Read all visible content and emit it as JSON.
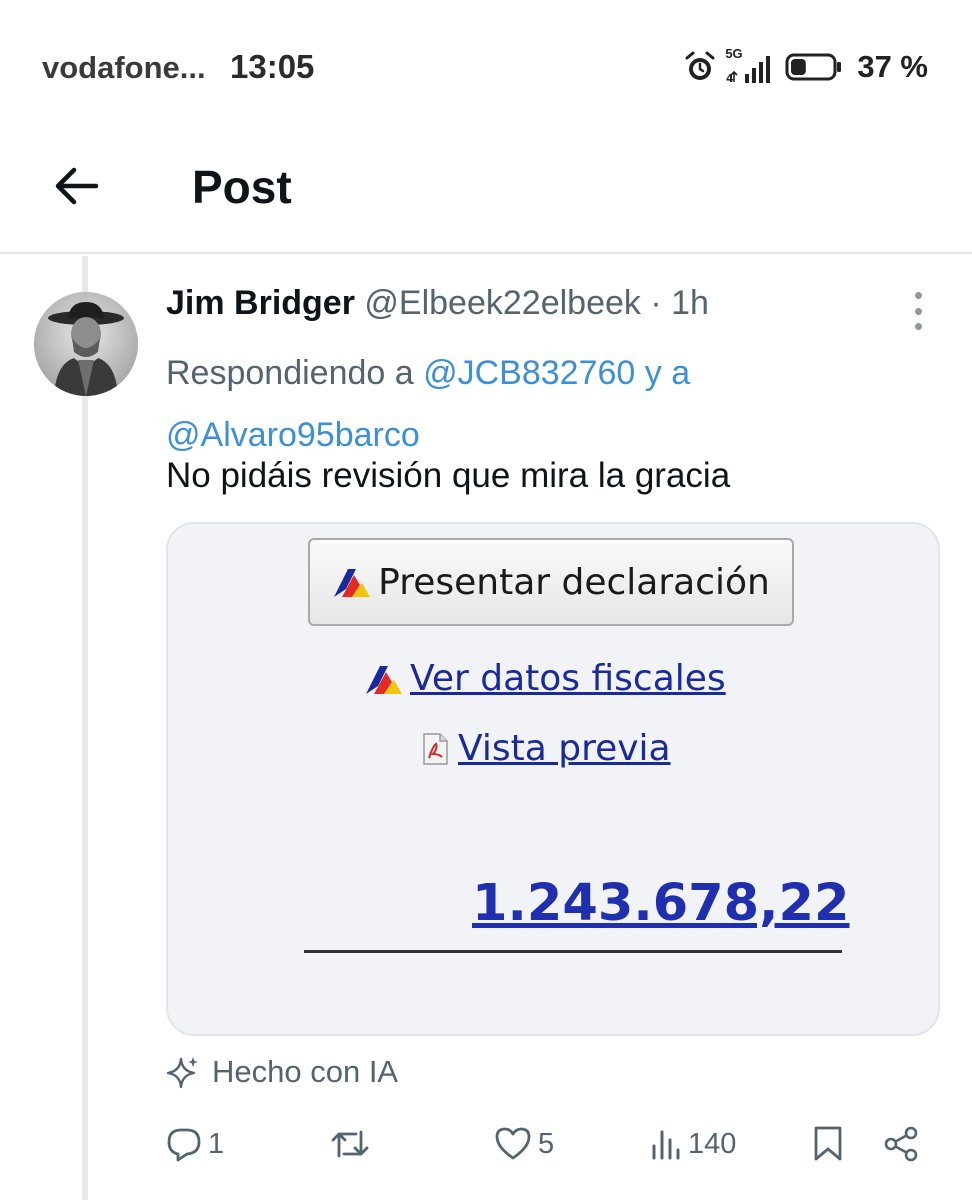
{
  "status_bar": {
    "carrier": "vodafone...",
    "time": "13:05",
    "network": "5G",
    "battery_percent": "37 %",
    "battery_level": 0.37,
    "icons": [
      "alarm-icon",
      "signal-icon",
      "battery-icon"
    ]
  },
  "header": {
    "title": "Post",
    "back_icon": "arrow-left-icon"
  },
  "tweet": {
    "author_name": "Jim Bridger",
    "author_handle": "@Elbeek22elbeek",
    "separator": "·",
    "time_ago": "1h",
    "reply_prefix": "Respondiendo a",
    "reply_mention_1": "@JCB832760",
    "reply_joiner": "y a",
    "reply_mention_2": "@Alvaro95barco",
    "text": "No pidáis revisión que mira la gracia"
  },
  "media": {
    "present_button": "Presentar declaración",
    "fiscal_link": "Ver datos fiscales",
    "preview_link": "Vista previa",
    "amount": "1.243.678,22"
  },
  "ai_label": "Hecho con IA",
  "actions": {
    "replies": "1",
    "reposts": "",
    "likes": "5",
    "views": "140"
  },
  "colors": {
    "link": "#3d8fd6",
    "secondary_text": "#536471",
    "amount": "#1f2fae"
  }
}
